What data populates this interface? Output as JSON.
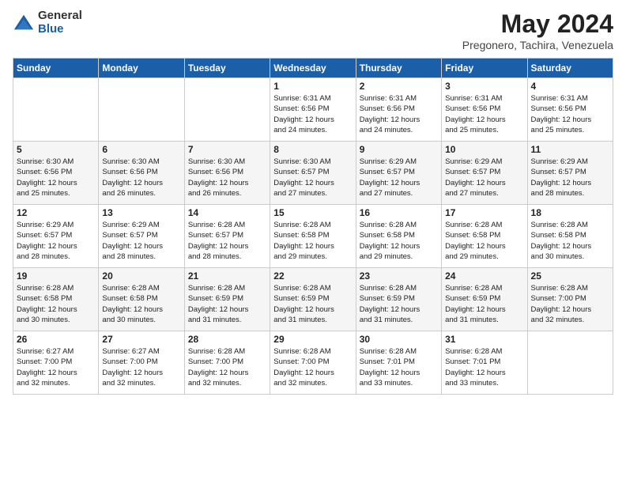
{
  "logo": {
    "general": "General",
    "blue": "Blue"
  },
  "title": "May 2024",
  "subtitle": "Pregonero, Tachira, Venezuela",
  "days_header": [
    "Sunday",
    "Monday",
    "Tuesday",
    "Wednesday",
    "Thursday",
    "Friday",
    "Saturday"
  ],
  "weeks": [
    [
      {
        "day": "",
        "info": ""
      },
      {
        "day": "",
        "info": ""
      },
      {
        "day": "",
        "info": ""
      },
      {
        "day": "1",
        "info": "Sunrise: 6:31 AM\nSunset: 6:56 PM\nDaylight: 12 hours\nand 24 minutes."
      },
      {
        "day": "2",
        "info": "Sunrise: 6:31 AM\nSunset: 6:56 PM\nDaylight: 12 hours\nand 24 minutes."
      },
      {
        "day": "3",
        "info": "Sunrise: 6:31 AM\nSunset: 6:56 PM\nDaylight: 12 hours\nand 25 minutes."
      },
      {
        "day": "4",
        "info": "Sunrise: 6:31 AM\nSunset: 6:56 PM\nDaylight: 12 hours\nand 25 minutes."
      }
    ],
    [
      {
        "day": "5",
        "info": "Sunrise: 6:30 AM\nSunset: 6:56 PM\nDaylight: 12 hours\nand 25 minutes."
      },
      {
        "day": "6",
        "info": "Sunrise: 6:30 AM\nSunset: 6:56 PM\nDaylight: 12 hours\nand 26 minutes."
      },
      {
        "day": "7",
        "info": "Sunrise: 6:30 AM\nSunset: 6:56 PM\nDaylight: 12 hours\nand 26 minutes."
      },
      {
        "day": "8",
        "info": "Sunrise: 6:30 AM\nSunset: 6:57 PM\nDaylight: 12 hours\nand 27 minutes."
      },
      {
        "day": "9",
        "info": "Sunrise: 6:29 AM\nSunset: 6:57 PM\nDaylight: 12 hours\nand 27 minutes."
      },
      {
        "day": "10",
        "info": "Sunrise: 6:29 AM\nSunset: 6:57 PM\nDaylight: 12 hours\nand 27 minutes."
      },
      {
        "day": "11",
        "info": "Sunrise: 6:29 AM\nSunset: 6:57 PM\nDaylight: 12 hours\nand 28 minutes."
      }
    ],
    [
      {
        "day": "12",
        "info": "Sunrise: 6:29 AM\nSunset: 6:57 PM\nDaylight: 12 hours\nand 28 minutes."
      },
      {
        "day": "13",
        "info": "Sunrise: 6:29 AM\nSunset: 6:57 PM\nDaylight: 12 hours\nand 28 minutes."
      },
      {
        "day": "14",
        "info": "Sunrise: 6:28 AM\nSunset: 6:57 PM\nDaylight: 12 hours\nand 28 minutes."
      },
      {
        "day": "15",
        "info": "Sunrise: 6:28 AM\nSunset: 6:58 PM\nDaylight: 12 hours\nand 29 minutes."
      },
      {
        "day": "16",
        "info": "Sunrise: 6:28 AM\nSunset: 6:58 PM\nDaylight: 12 hours\nand 29 minutes."
      },
      {
        "day": "17",
        "info": "Sunrise: 6:28 AM\nSunset: 6:58 PM\nDaylight: 12 hours\nand 29 minutes."
      },
      {
        "day": "18",
        "info": "Sunrise: 6:28 AM\nSunset: 6:58 PM\nDaylight: 12 hours\nand 30 minutes."
      }
    ],
    [
      {
        "day": "19",
        "info": "Sunrise: 6:28 AM\nSunset: 6:58 PM\nDaylight: 12 hours\nand 30 minutes."
      },
      {
        "day": "20",
        "info": "Sunrise: 6:28 AM\nSunset: 6:58 PM\nDaylight: 12 hours\nand 30 minutes."
      },
      {
        "day": "21",
        "info": "Sunrise: 6:28 AM\nSunset: 6:59 PM\nDaylight: 12 hours\nand 31 minutes."
      },
      {
        "day": "22",
        "info": "Sunrise: 6:28 AM\nSunset: 6:59 PM\nDaylight: 12 hours\nand 31 minutes."
      },
      {
        "day": "23",
        "info": "Sunrise: 6:28 AM\nSunset: 6:59 PM\nDaylight: 12 hours\nand 31 minutes."
      },
      {
        "day": "24",
        "info": "Sunrise: 6:28 AM\nSunset: 6:59 PM\nDaylight: 12 hours\nand 31 minutes."
      },
      {
        "day": "25",
        "info": "Sunrise: 6:28 AM\nSunset: 7:00 PM\nDaylight: 12 hours\nand 32 minutes."
      }
    ],
    [
      {
        "day": "26",
        "info": "Sunrise: 6:27 AM\nSunset: 7:00 PM\nDaylight: 12 hours\nand 32 minutes."
      },
      {
        "day": "27",
        "info": "Sunrise: 6:27 AM\nSunset: 7:00 PM\nDaylight: 12 hours\nand 32 minutes."
      },
      {
        "day": "28",
        "info": "Sunrise: 6:28 AM\nSunset: 7:00 PM\nDaylight: 12 hours\nand 32 minutes."
      },
      {
        "day": "29",
        "info": "Sunrise: 6:28 AM\nSunset: 7:00 PM\nDaylight: 12 hours\nand 32 minutes."
      },
      {
        "day": "30",
        "info": "Sunrise: 6:28 AM\nSunset: 7:01 PM\nDaylight: 12 hours\nand 33 minutes."
      },
      {
        "day": "31",
        "info": "Sunrise: 6:28 AM\nSunset: 7:01 PM\nDaylight: 12 hours\nand 33 minutes."
      },
      {
        "day": "",
        "info": ""
      }
    ]
  ]
}
